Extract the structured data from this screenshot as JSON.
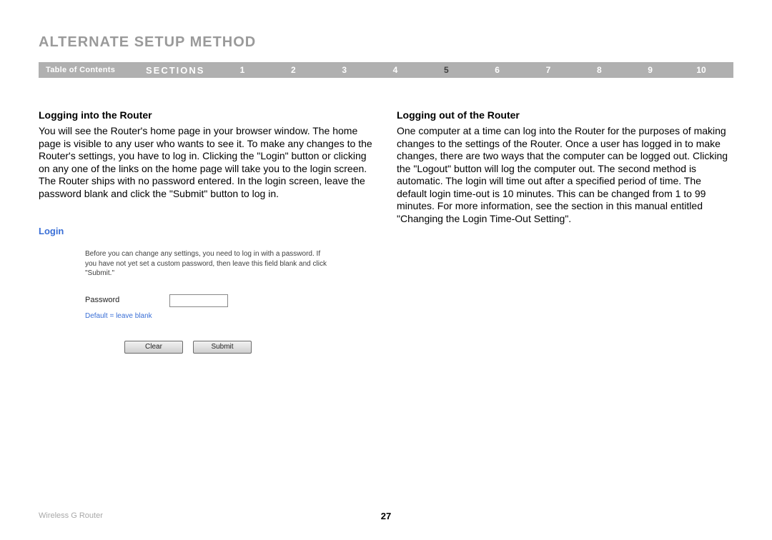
{
  "header": {
    "title": "ALTERNATE SETUP METHOD"
  },
  "nav": {
    "toc": "Table of Contents",
    "sections_label": "SECTIONS",
    "items": [
      "1",
      "2",
      "3",
      "4",
      "5",
      "6",
      "7",
      "8",
      "9",
      "10"
    ],
    "active": "5"
  },
  "left": {
    "heading": "Logging into the Router",
    "body": "You will see the Router's home page in your browser window. The home page is visible to any user who wants to see it. To make any changes to the Router's settings, you have to log in. Clicking the \"Login\" button or clicking on any one of the links on the home page will take you to the login screen. The Router ships with no password entered. In the login screen, leave the password blank and click the \"Submit\" button to log in."
  },
  "right": {
    "heading": "Logging out of the Router",
    "body": "One computer at a time can log into the Router for the purposes of making changes to the settings of the Router. Once a user has logged in to make changes, there are two ways that the computer can be logged out. Clicking the \"Logout\" button will log the computer out. The second method is automatic. The login will time out after a specified period of time. The default login time-out is 10 minutes. This can be changed from 1 to 99 minutes. For more information, see the section in this manual entitled \"Changing the Login Time-Out Setting\"."
  },
  "login_panel": {
    "title": "Login",
    "intro": "Before you can change any settings, you need to log in with a password. If you have not yet set a custom password, then leave this field blank and click \"Submit.\"",
    "pw_label": "Password",
    "default_hint": "Default = leave blank",
    "clear_btn": "Clear",
    "submit_btn": "Submit"
  },
  "footer": {
    "product": "Wireless G Router",
    "page": "27"
  }
}
